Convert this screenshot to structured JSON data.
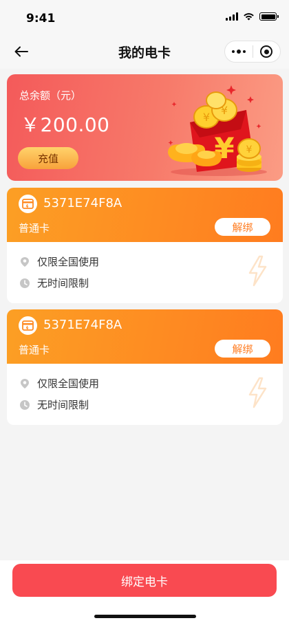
{
  "status_bar": {
    "time": "9:41"
  },
  "nav": {
    "title": "我的电卡"
  },
  "balance": {
    "label": "总余额（元）",
    "amount": "￥200.00",
    "recharge_label": "充值"
  },
  "cards": [
    {
      "number": "5371E74F8A",
      "type": "普通卡",
      "unbind_label": "解绑",
      "region": "仅限全国使用",
      "time_limit": "无时间限制"
    },
    {
      "number": "5371E74F8A",
      "type": "普通卡",
      "unbind_label": "解绑",
      "region": "仅限全国使用",
      "time_limit": "无时间限制"
    }
  ],
  "bottom": {
    "bind_label": "绑定电卡"
  },
  "icons": {
    "back": "back-arrow-icon",
    "more": "more-dots-icon",
    "close": "target-icon",
    "card": "card-icon",
    "location": "location-pin-icon",
    "clock": "clock-icon",
    "bolt": "lightning-bolt-icon"
  },
  "colors": {
    "accent_red": "#f94a51",
    "card_orange": "#fe8a22",
    "balance_red": "#f45a5a"
  }
}
